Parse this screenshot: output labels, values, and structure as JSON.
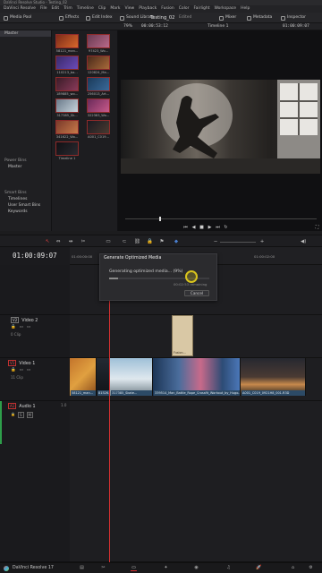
{
  "window": {
    "title": "DaVinci Resolve Studio - Testing_02"
  },
  "menu": {
    "items": [
      "DaVinci Resolve",
      "File",
      "Edit",
      "Trim",
      "Timeline",
      "Clip",
      "Mark",
      "View",
      "Playback",
      "Fusion",
      "Color",
      "Fairlight",
      "Workspace",
      "Help"
    ]
  },
  "toolbar": {
    "media_pool": "Media Pool",
    "effects": "Effects",
    "edit_index": "Edit Index",
    "sound_library": "Sound Library",
    "project_name": "Testing_02",
    "project_status": "Edited",
    "mixer": "Mixer",
    "metadata": "Metadata",
    "inspector": "Inspector"
  },
  "viewer": {
    "zoom": "79%",
    "source_timecode": "00:00:53:12",
    "timeline_name": "Timeline 1",
    "record_timecode": "01:00:09:07"
  },
  "bins": {
    "master": "Master",
    "power_bins_title": "Power Bins",
    "power_master": "Master",
    "smart_bins_title": "Smart Bins",
    "smart_items": [
      "Timelines",
      "User Smart Bins",
      "Keywords"
    ]
  },
  "media_clips": [
    {
      "name": "58121_man..."
    },
    {
      "name": "97423_Wo..."
    },
    {
      "name": "110213_ba..."
    },
    {
      "name": "120824_Ma..."
    },
    {
      "name": "189885_wo..."
    },
    {
      "name": "256013_Art..."
    },
    {
      "name": "317385_Sk..."
    },
    {
      "name": "322383_Wo..."
    },
    {
      "name": "341622_Wo..."
    },
    {
      "name": "A001_C019..."
    },
    {
      "name": "Timeline 1"
    }
  ],
  "timeline": {
    "timecode": "01:00:09:07",
    "ruler_marks": [
      "01:00:00:00",
      "01:00:02:00"
    ],
    "tracks": [
      {
        "id": "V2",
        "name": "Video 2",
        "clips": "0 Clip"
      },
      {
        "id": "V1",
        "name": "Video 1",
        "clips": "11 Clip"
      },
      {
        "id": "A1",
        "name": "Audio 1",
        "level": "1.0"
      }
    ],
    "v1_clips": [
      "58121_man...",
      "81526...",
      "317385_Skate...",
      "339514_Man_Battle_Rope_Crossfit_Workout_by_Hugo...",
      "A001_C019_0921H8_001.R3D"
    ],
    "v2_clip": "Fusion..."
  },
  "dialog": {
    "title": "Generate Optimized Media",
    "message": "Generating optimized media... (9%)",
    "remaining": "00:02:53 remaining",
    "progress_percent": 9,
    "cancel": "Cancel"
  },
  "bottom": {
    "app": "DaVinci Resolve 17"
  },
  "colors": {
    "accent_red": "#d63030",
    "clip_blue": "#2c4a66",
    "thumb_border": "#8e2a2a"
  }
}
